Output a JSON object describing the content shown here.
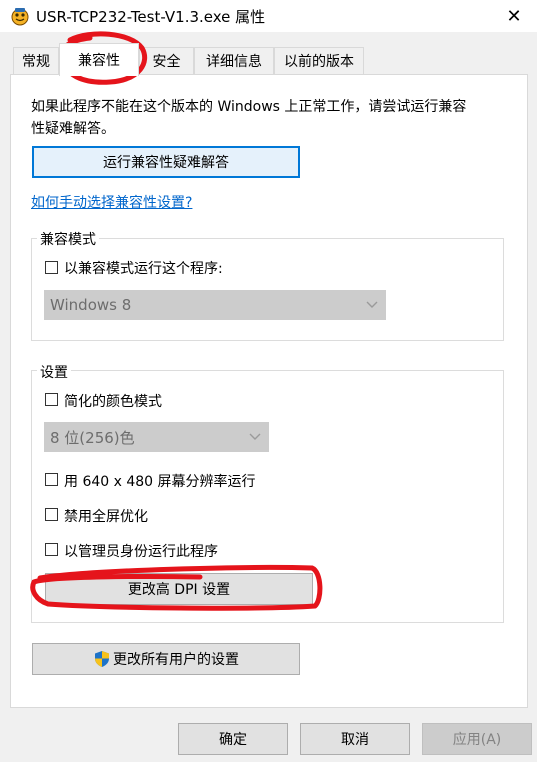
{
  "window": {
    "title": "USR-TCP232-Test-V1.3.exe 属性",
    "close_icon": "✕"
  },
  "tabs": [
    {
      "label": "常规"
    },
    {
      "label": "兼容性"
    },
    {
      "label": "安全"
    },
    {
      "label": "详细信息"
    },
    {
      "label": "以前的版本"
    }
  ],
  "active_tab": "兼容性",
  "compat": {
    "intro_line1": "如果此程序不能在这个版本的 Windows 上正常工作，请尝试运行兼容",
    "intro_line2": "性疑难解答。",
    "troubleshooter_button": "运行兼容性疑难解答",
    "manual_link": "如何手动选择兼容性设置?"
  },
  "compat_mode": {
    "legend": "兼容模式",
    "checkbox_label": "以兼容模式运行这个程序:",
    "checked": false,
    "os_select_value": "Windows 8"
  },
  "settings": {
    "legend": "设置",
    "reduced_color_label": "简化的颜色模式",
    "color_select_value": "8 位(256)色",
    "res_640_label": "用 640 x 480 屏幕分辨率运行",
    "disable_fullscreen_label": "禁用全屏优化",
    "run_as_admin_label": "以管理员身份运行此程序",
    "dpi_button": "更改高 DPI 设置"
  },
  "all_users_button": "更改所有用户的设置",
  "footer": {
    "ok": "确定",
    "cancel": "取消",
    "apply": "应用(A)"
  },
  "colors": {
    "annotation_red": "#e5141b",
    "focus_blue": "#0078d7",
    "link_blue": "#0066cc"
  }
}
